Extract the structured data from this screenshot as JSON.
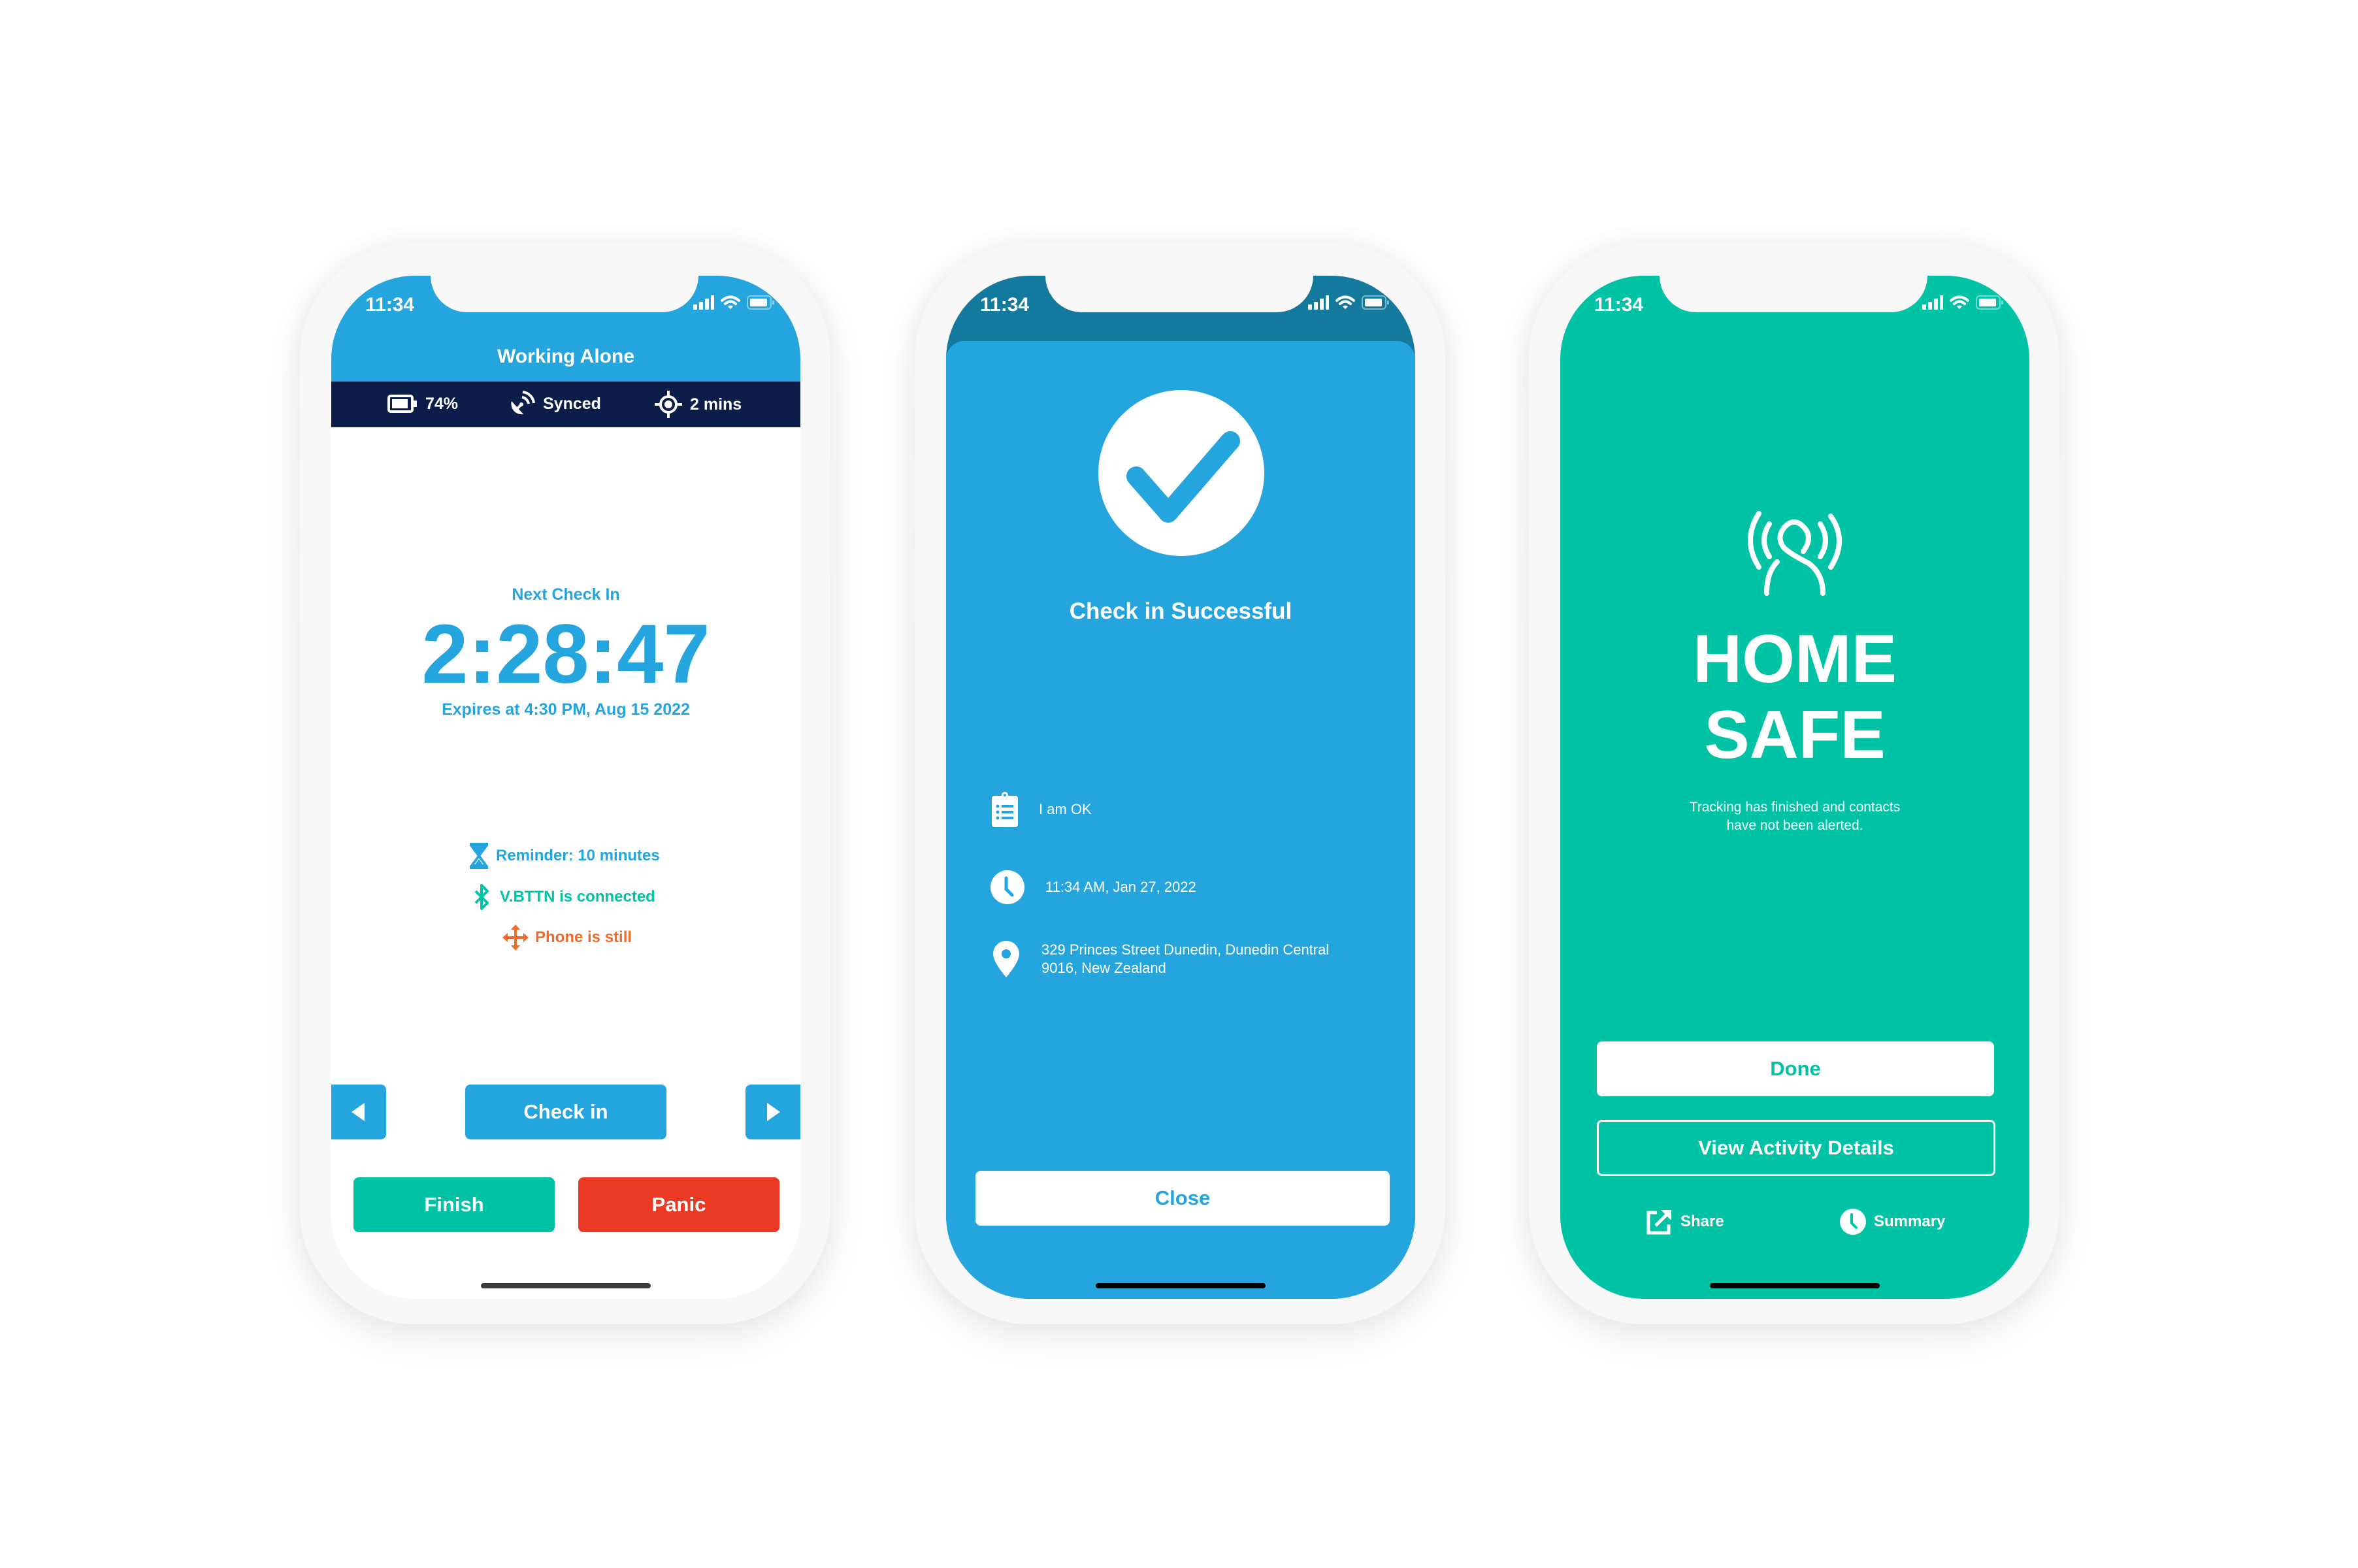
{
  "colors": {
    "blue": "#25A5DE",
    "dark_blue": "#137A9E",
    "navy": "#0B1D48",
    "teal": "#00C3A6",
    "red": "#EB3A24",
    "orange": "#F26B2A",
    "white": "#FFFFFF"
  },
  "status_bar": {
    "time": "11:34"
  },
  "phone1": {
    "header_title": "Working Alone",
    "info_bar": [
      {
        "icon": "battery-icon",
        "label": "74%"
      },
      {
        "icon": "satellite-dish-icon",
        "label": "Synced"
      },
      {
        "icon": "location-target-icon",
        "label": "2 mins"
      }
    ],
    "next_check_label": "Next Check In",
    "countdown": "2:28:47",
    "expires": "Expires at 4:30 PM, Aug 15 2022",
    "status_items": [
      {
        "icon": "hourglass-icon",
        "label": "Reminder: 10 minutes",
        "color": "#25A5DE"
      },
      {
        "icon": "bluetooth-icon",
        "label": "V.BTTN is connected",
        "color": "#00C3A6"
      },
      {
        "icon": "move-arrows-icon",
        "label": "Phone is still",
        "color": "#F26B2A"
      }
    ],
    "check_in_label": "Check in",
    "finish_label": "Finish",
    "panic_label": "Panic"
  },
  "phone2": {
    "title": "Check in Successful",
    "details": [
      {
        "icon": "clipboard-list-icon",
        "text": "I am OK"
      },
      {
        "icon": "clock-icon",
        "text": "11:34 AM, Jan 27, 2022"
      },
      {
        "icon": "map-pin-icon",
        "line1": "329 Princes Street Dunedin, Dunedin Central",
        "line2": "9016, New Zealand"
      }
    ],
    "close_label": "Close"
  },
  "phone3": {
    "title_line1": "HOME",
    "title_line2": "SAFE",
    "subtitle_line1": "Tracking has finished and contacts",
    "subtitle_line2": "have not been alerted.",
    "done_label": "Done",
    "view_details_label": "View Activity Details",
    "share_label": "Share",
    "summary_label": "Summary"
  }
}
